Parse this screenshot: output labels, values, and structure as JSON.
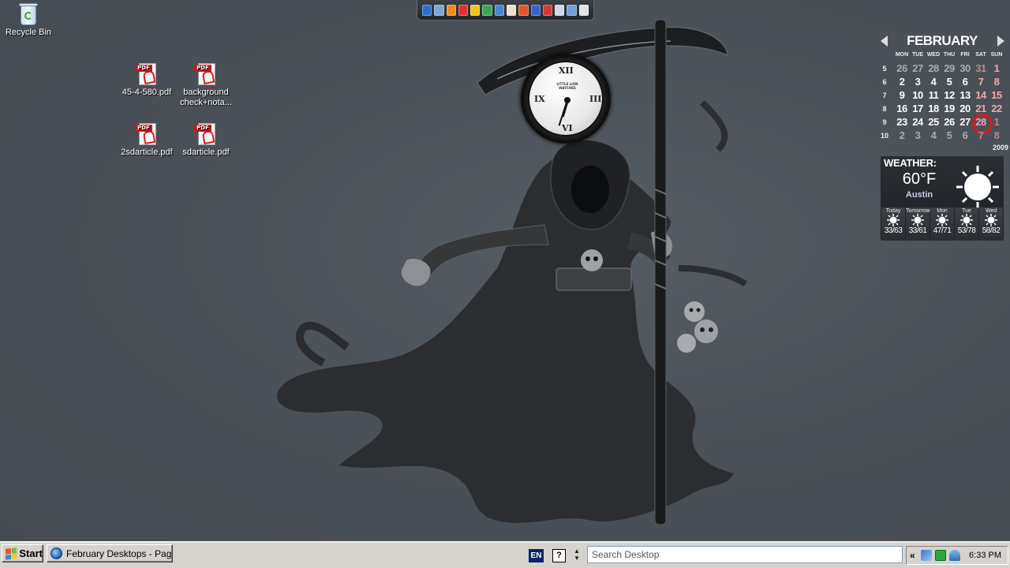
{
  "desktop": {
    "icons": [
      {
        "label": "Recycle Bin",
        "icon": "recycle-bin-icon"
      },
      {
        "label": "45-4-580.pdf",
        "icon": "pdf-icon"
      },
      {
        "label": "background check+nota...",
        "icon": "pdf-icon"
      },
      {
        "label": "2sdarticle.pdf",
        "icon": "pdf-icon"
      },
      {
        "label": "sdarticle.pdf",
        "icon": "pdf-icon"
      }
    ],
    "pdf_badge": "PDF",
    "dock_colors": [
      "#2d6fd1",
      "#7aa7d8",
      "#f28a1c",
      "#e23030",
      "#f0c419",
      "#3aa655",
      "#4a86d8",
      "#e8e0c8",
      "#e05530",
      "#3b62c8",
      "#d43838",
      "#cfd8e6",
      "#6fa0d8",
      "#e0e4ea"
    ]
  },
  "clock_widget": {
    "numerals": {
      "top": "XII",
      "right": "III",
      "bottom": "VI",
      "left": "IX"
    },
    "brand": "LITTLE LION WATCHES",
    "hour": 6,
    "minute": 33
  },
  "calendar": {
    "month": "FEBRUARY",
    "year": "2009",
    "dow": [
      "MON",
      "TUE",
      "WED",
      "THU",
      "FRI",
      "SAT",
      "SUN"
    ],
    "weeks": [
      {
        "num": "5",
        "days": [
          "26",
          "27",
          "28",
          "29",
          "30",
          "31",
          "1"
        ],
        "dim": [
          true,
          true,
          true,
          true,
          true,
          true,
          false
        ]
      },
      {
        "num": "6",
        "days": [
          "2",
          "3",
          "4",
          "5",
          "6",
          "7",
          "8"
        ],
        "dim": [
          false,
          false,
          false,
          false,
          false,
          false,
          false
        ]
      },
      {
        "num": "7",
        "days": [
          "9",
          "10",
          "11",
          "12",
          "13",
          "14",
          "15"
        ],
        "dim": [
          false,
          false,
          false,
          false,
          false,
          false,
          false
        ]
      },
      {
        "num": "8",
        "days": [
          "16",
          "17",
          "18",
          "19",
          "20",
          "21",
          "22"
        ],
        "dim": [
          false,
          false,
          false,
          false,
          false,
          false,
          false
        ]
      },
      {
        "num": "9",
        "days": [
          "23",
          "24",
          "25",
          "26",
          "27",
          "28",
          "1"
        ],
        "dim": [
          false,
          false,
          false,
          false,
          false,
          false,
          true
        ]
      },
      {
        "num": "10",
        "days": [
          "2",
          "3",
          "4",
          "5",
          "6",
          "7",
          "8"
        ],
        "dim": [
          true,
          true,
          true,
          true,
          true,
          true,
          true
        ]
      }
    ],
    "today": "28"
  },
  "weather": {
    "title": "WEATHER:",
    "temp": "60°F",
    "city": "Austin",
    "forecast": [
      {
        "day": "Today",
        "range": "33/63"
      },
      {
        "day": "Tomorrow",
        "range": "33/61"
      },
      {
        "day": "Mon",
        "range": "47/71"
      },
      {
        "day": "Tue",
        "range": "53/78"
      },
      {
        "day": "Wed",
        "range": "58/82"
      }
    ]
  },
  "taskbar": {
    "start_label": "Start",
    "task_label": "February Desktops - Pag...",
    "language": "EN",
    "help": "?",
    "search_placeholder": "Search Desktop",
    "tray_chevron": "«",
    "time": "6:33 PM"
  }
}
